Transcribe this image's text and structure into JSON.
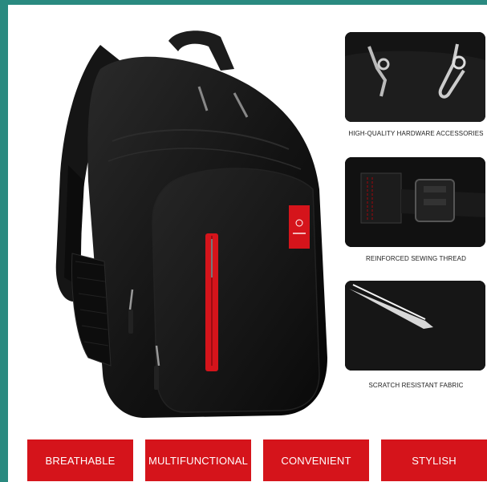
{
  "details": [
    {
      "caption": "HIGH-QUALITY HARDWARE ACCESSORIES",
      "icon": "zipper-puller-photo"
    },
    {
      "caption": "REINFORCED SEWING THREAD",
      "icon": "strap-buckle-photo"
    },
    {
      "caption": "SCRATCH RESISTANT FABRIC",
      "icon": "scissors-fabric-photo"
    }
  ],
  "features": [
    "BREATHABLE",
    "MULTIFUNCTIONAL",
    "CONVENIENT",
    "STYLISH"
  ],
  "colors": {
    "accent": "#d5141b",
    "frame": "#2a8a80",
    "bag": "#111111"
  }
}
